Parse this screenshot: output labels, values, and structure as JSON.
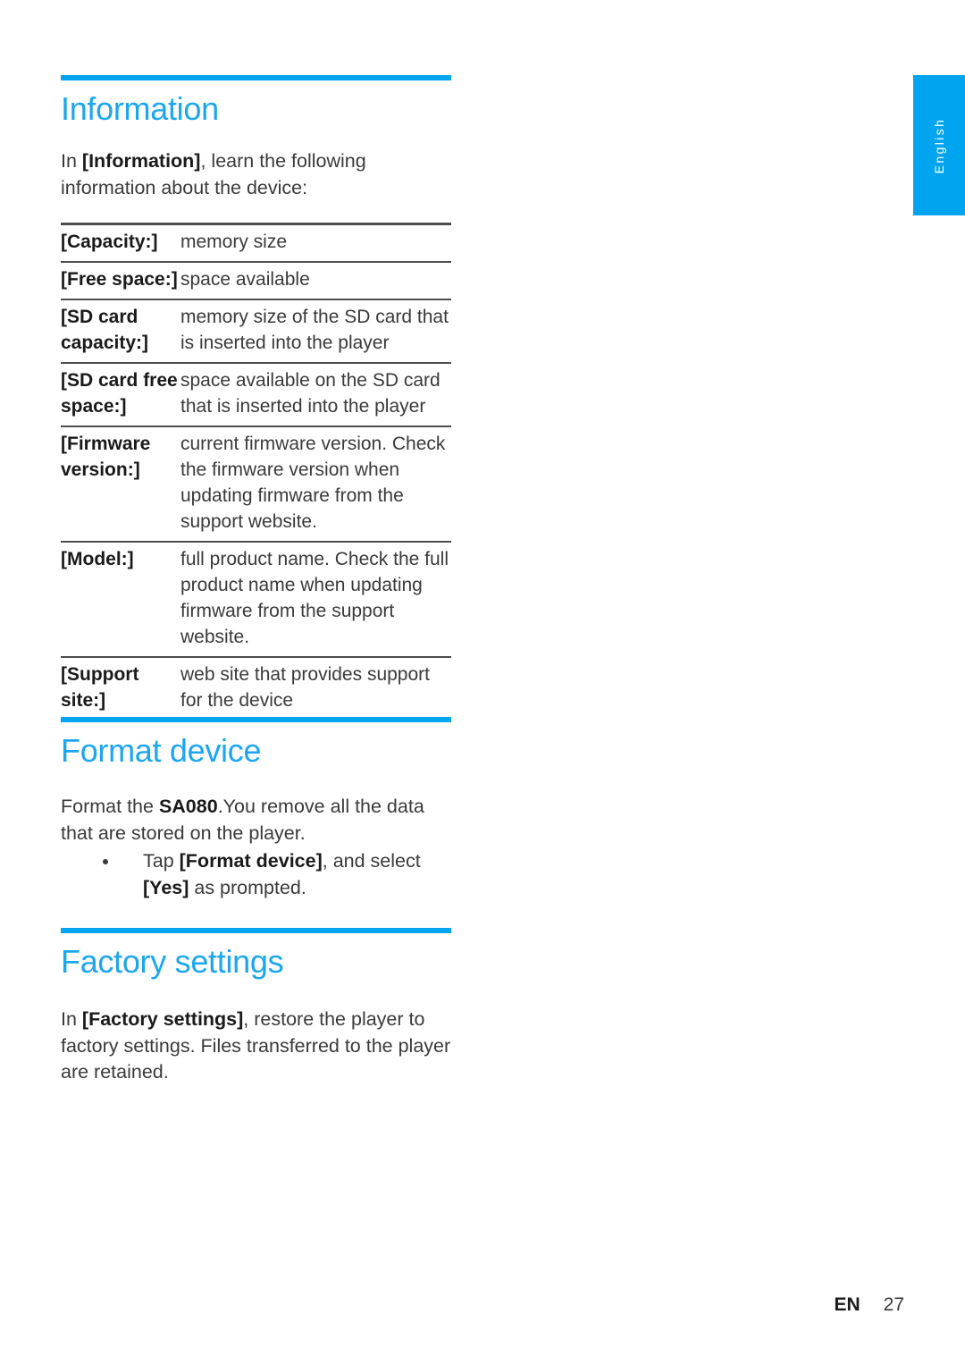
{
  "page": {
    "language_tab": "English",
    "accent_rule_color": "#00A4EF",
    "heading_color": "#1BA6F0"
  },
  "sections": {
    "information": {
      "heading": "Information",
      "intro_prefix": "In ",
      "intro_bold": "[Information]",
      "intro_suffix": ", learn the following information about the device:",
      "table": {
        "rows": [
          {
            "key": "[Capacity:]",
            "value": "memory size"
          },
          {
            "key": "[Free space:]",
            "value": "space available"
          },
          {
            "key": "[SD card capacity:]",
            "value": "memory size of the SD card that is inserted into the player"
          },
          {
            "key": "[SD card free space:]",
            "value": "space available on the SD card that is inserted into the player"
          },
          {
            "key": "[Firmware version:]",
            "value": "current firmware version. Check the firmware version when updating firmware from the support website."
          },
          {
            "key": "[Model:]",
            "value": "full product name. Check the full product name when updating firmware from the support website."
          },
          {
            "key": "[Support site:]",
            "value": "web site that provides support for the device"
          }
        ]
      }
    },
    "format_device": {
      "heading": "Format device",
      "intro_prefix": "Format the ",
      "intro_bold": "SA080",
      "intro_suffix": ".You remove all the data that are stored on the player.",
      "bullet_prefix": "Tap ",
      "bullet_bold1": "[Format device]",
      "bullet_middle": ", and select ",
      "bullet_bold2": "[Yes]",
      "bullet_suffix": " as prompted."
    },
    "factory_settings": {
      "heading": "Factory settings",
      "intro_prefix": "In ",
      "intro_bold": "[Factory settings]",
      "intro_suffix": ", restore the player to factory settings. Files transferred to the player are retained."
    }
  },
  "footer": {
    "language_code": "EN",
    "page_number": "27"
  }
}
